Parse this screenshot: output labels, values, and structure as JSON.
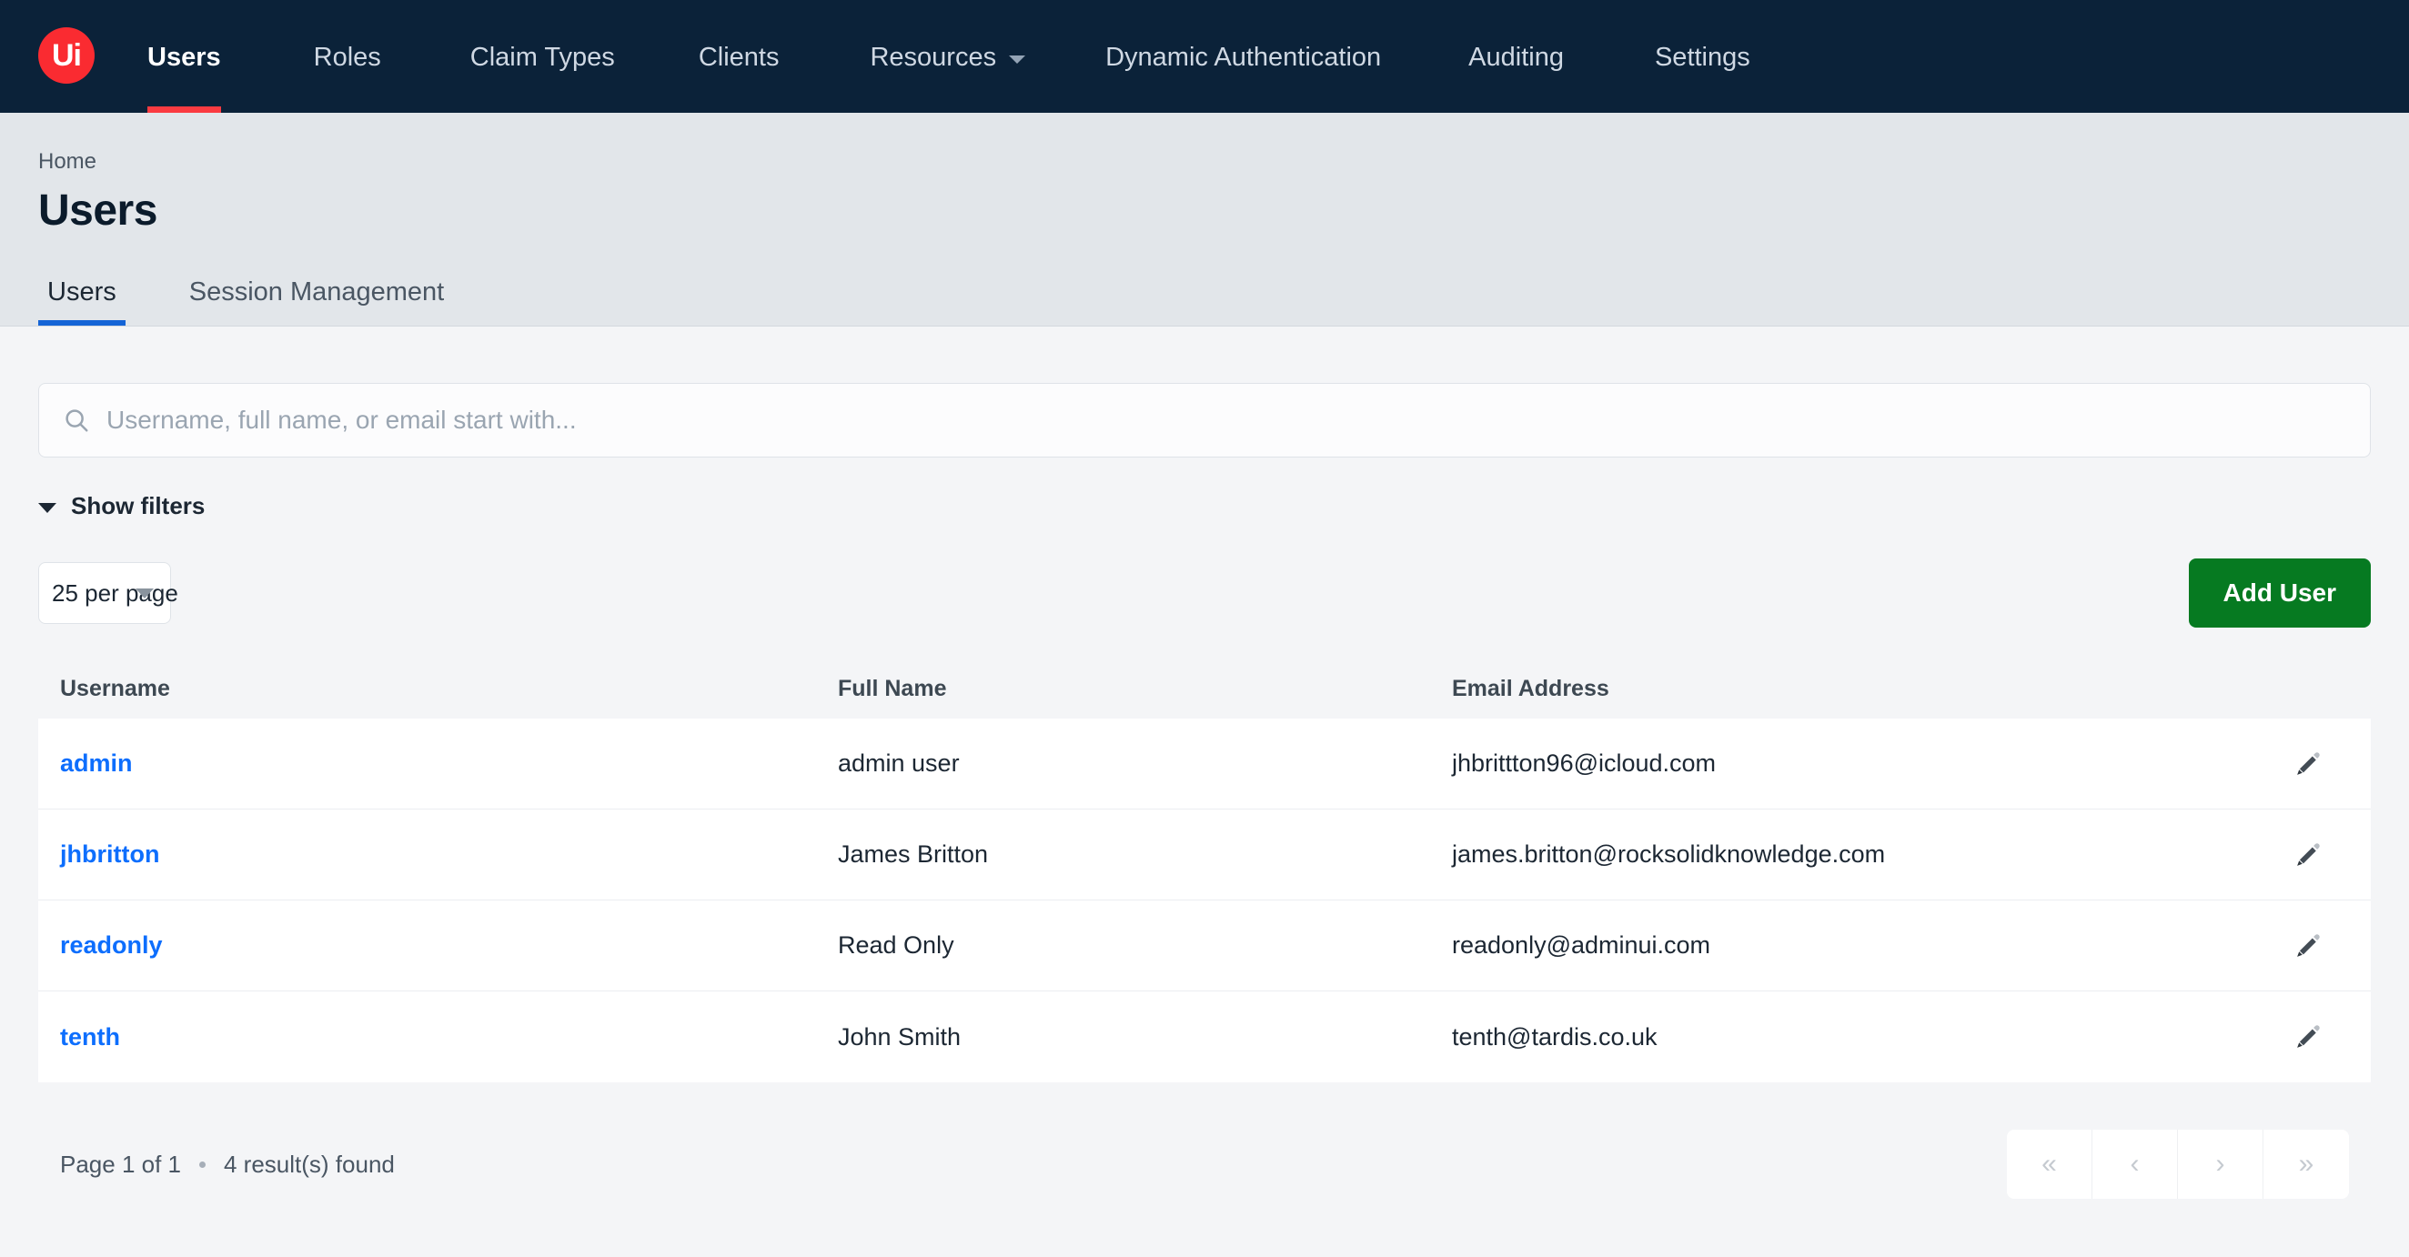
{
  "brand": {
    "logo_text": "Ui",
    "logo_color": "#fa2b31"
  },
  "topnav": {
    "background": "#0b2239",
    "active_underline_color": "#fa3b41",
    "items": [
      {
        "label": "Users",
        "active": true,
        "has_caret": false
      },
      {
        "label": "Roles",
        "active": false,
        "has_caret": false
      },
      {
        "label": "Claim Types",
        "active": false,
        "has_caret": false
      },
      {
        "label": "Clients",
        "active": false,
        "has_caret": false
      },
      {
        "label": "Resources",
        "active": false,
        "has_caret": true
      },
      {
        "label": "Dynamic Authentication",
        "active": false,
        "has_caret": false
      },
      {
        "label": "Auditing",
        "active": false,
        "has_caret": false
      },
      {
        "label": "Settings",
        "active": false,
        "has_caret": false
      }
    ]
  },
  "header": {
    "breadcrumb": "Home",
    "title": "Users"
  },
  "tabs": {
    "active_underline_color": "#1464d6",
    "items": [
      {
        "label": "Users",
        "active": true
      },
      {
        "label": "Session Management",
        "active": false
      }
    ]
  },
  "search": {
    "icon": "search-icon",
    "value": "",
    "placeholder": "Username, full name, or email start with..."
  },
  "filters": {
    "toggle_label": "Show filters",
    "icon": "chevron-down-icon"
  },
  "toolbar": {
    "per_page_value": "25 per page",
    "add_user_label": "Add User",
    "add_user_color": "#067a21"
  },
  "table": {
    "columns": [
      "Username",
      "Full Name",
      "Email Address"
    ],
    "row_action_icon": "pencil-icon",
    "link_color": "#0d6efd",
    "rows": [
      {
        "username": "admin",
        "full_name": "admin user",
        "email": "jhbrittton96@icloud.com"
      },
      {
        "username": "jhbritton",
        "full_name": "James Britton",
        "email": "james.britton@rocksolidknowledge.com"
      },
      {
        "username": "readonly",
        "full_name": "Read Only",
        "email": "readonly@adminui.com"
      },
      {
        "username": "tenth",
        "full_name": "John Smith",
        "email": "tenth@tardis.co.uk"
      }
    ]
  },
  "footer": {
    "page_status": "Page 1 of 1",
    "result_status": "4 result(s) found",
    "pager": [
      {
        "glyph": "«",
        "name": "first-page"
      },
      {
        "glyph": "‹",
        "name": "previous-page"
      },
      {
        "glyph": "›",
        "name": "next-page"
      },
      {
        "glyph": "»",
        "name": "last-page"
      }
    ]
  }
}
